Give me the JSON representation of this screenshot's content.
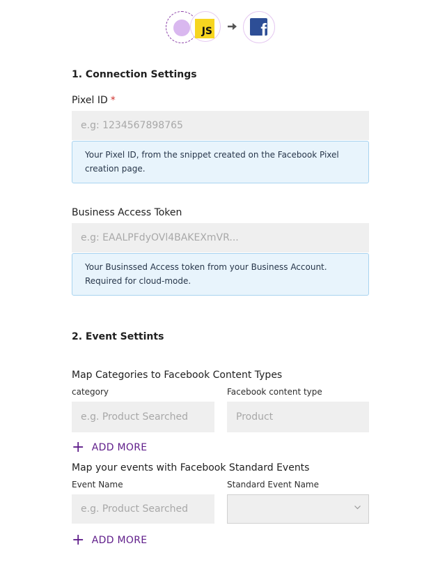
{
  "header": {
    "js_badge": "JS",
    "fb_glyph": "f"
  },
  "connection": {
    "title": "1. Connection Settings",
    "pixel_id": {
      "label": "Pixel ID",
      "required_mark": "*",
      "placeholder": "e.g: 1234567898765",
      "help": "Your Pixel ID, from the snippet created on the Facebook Pixel creation page."
    },
    "token": {
      "label": "Business Access Token",
      "placeholder": "e.g: EAALPFdyOVl4BAKEXmVR...",
      "help": "Your Businssed Access token from your Business Account. Required for cloud-mode."
    }
  },
  "events": {
    "title": "2. Event Settints",
    "categories": {
      "title": "Map Categories to Facebook Content Types",
      "col1_label": "category",
      "col2_label": "Facebook content type",
      "col1_placeholder": "e.g. Product Searched",
      "col2_placeholder": "Product",
      "add_more": "ADD MORE"
    },
    "standard": {
      "title": "Map your events with Facebook Standard Events",
      "col1_label": "Event Name",
      "col2_label": "Standard Event Name",
      "col1_placeholder": "e.g. Product Searched",
      "select_value": "",
      "add_more": "ADD MORE"
    }
  },
  "colors": {
    "accent": "#5f1d8a",
    "info_bg": "#e8f4fc",
    "info_border": "#a8d3f0",
    "input_bg": "#efefef",
    "required": "#d0312d",
    "js_yellow": "#f6d520",
    "facebook_blue": "#2d4e96"
  },
  "icons": [
    "source-dot-icon",
    "javascript-icon",
    "arrow-right-icon",
    "facebook-icon",
    "plus-icon",
    "chevron-down-icon"
  ]
}
